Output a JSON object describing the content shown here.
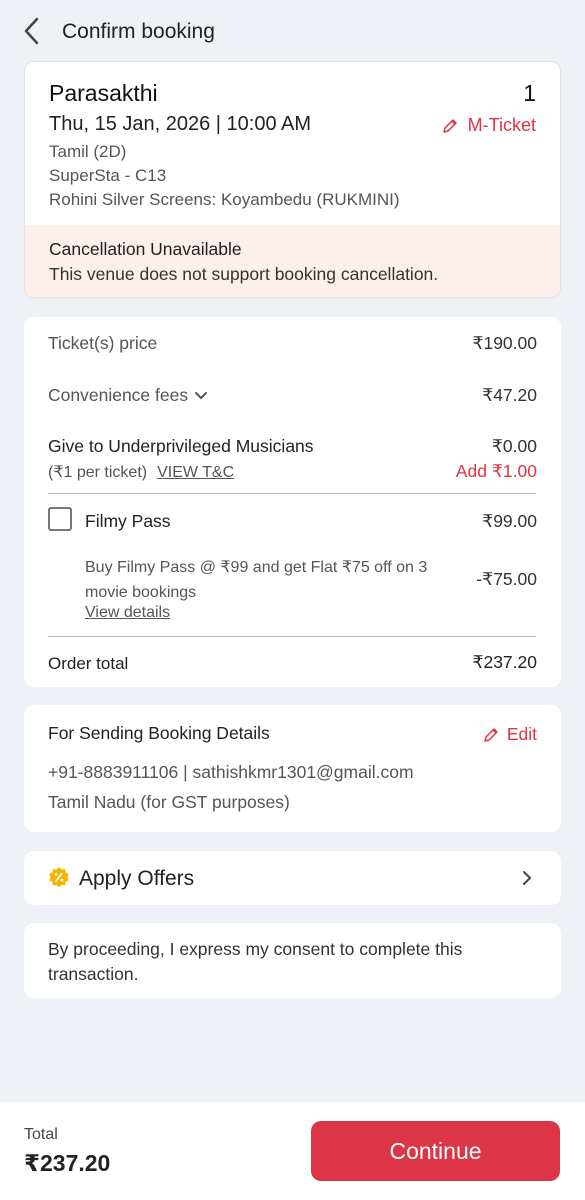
{
  "header": {
    "title": "Confirm booking"
  },
  "booking": {
    "movie": "Parasakthi",
    "quantity": "1",
    "datetime": "Thu, 15 Jan, 2026 | 10:00 AM",
    "ticket_type": "M-Ticket",
    "language": "Tamil (2D)",
    "seat": "SuperSta - C13",
    "venue": "Rohini Silver Screens: Koyambedu (RUKMINI)",
    "cancellation": {
      "title": "Cancellation Unavailable",
      "message": "This venue does not support booking cancellation."
    }
  },
  "summary": {
    "ticket_price_label": "Ticket(s) price",
    "ticket_price": "₹190.00",
    "convenience_label": "Convenience fees",
    "convenience_fee": "₹47.20",
    "donation_label": "Give to Underprivileged Musicians",
    "donation_amount": "₹0.00",
    "donation_sub": "(₹1 per ticket)",
    "donation_tc": "VIEW T&C",
    "donation_add": "Add ₹1.00",
    "pass_label": "Filmy Pass",
    "pass_price": "₹99.00",
    "pass_desc": "Buy Filmy Pass @ ₹99 and get Flat ₹75 off on 3 movie bookings",
    "pass_discount": "-₹75.00",
    "pass_view": "View details",
    "order_total_label": "Order total",
    "order_total": "₹237.20"
  },
  "contact": {
    "title": "For Sending Booking Details",
    "edit_label": "Edit",
    "details": "+91-8883911106 | sathishkmr1301@gmail.com",
    "state": "Tamil Nadu (for GST purposes)"
  },
  "offers": {
    "label": "Apply Offers"
  },
  "consent": {
    "text": "By proceeding, I express my consent to complete this transaction."
  },
  "footer": {
    "total_label": "Total",
    "total_amount": "₹237.20",
    "continue_label": "Continue"
  },
  "colors": {
    "accent": "#dc3545",
    "background": "#eef1f6",
    "cancel_bg": "#fcefec",
    "offer_badge": "#f5b400"
  }
}
